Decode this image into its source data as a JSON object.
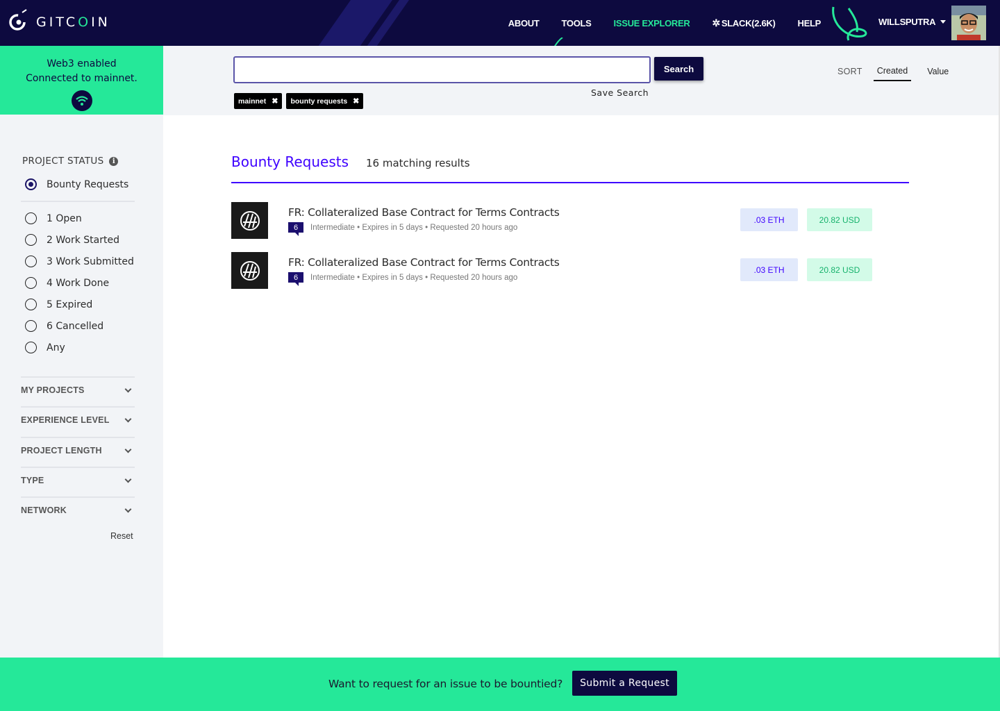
{
  "brand": {
    "logo_text_pre": "GITC",
    "logo_text_o": "O",
    "logo_text_post": "IN",
    "accent": "#25e899",
    "navy": "#0d0a3f",
    "purple": "#3e00ff"
  },
  "nav": {
    "about": "ABOUT",
    "tools": "TOOLS",
    "issue_explorer": "ISSUE EXPLORER",
    "slack": "SLACK(2.6K)",
    "help": "HELP",
    "user": "WILLSPUTRA"
  },
  "web3": {
    "line1": "Web3 enabled",
    "line2": "Connected to mainnet."
  },
  "sidebar": {
    "project_status_label": "PROJECT STATUS",
    "statuses": [
      "Bounty Requests",
      "1 Open",
      "2 Work Started",
      "3 Work Submitted",
      "4 Work Done",
      "5 Expired",
      "6 Cancelled",
      "Any"
    ],
    "selected_status": "Bounty Requests",
    "filters": [
      "MY PROJECTS",
      "EXPERIENCE LEVEL",
      "PROJECT LENGTH",
      "TYPE",
      "NETWORK"
    ],
    "reset": "Reset"
  },
  "search": {
    "value": "",
    "button": "Search",
    "save": "Save Search",
    "chips": [
      "mainnet",
      "bounty requests"
    ]
  },
  "sort": {
    "label": "SORT",
    "options": [
      "Created",
      "Value"
    ],
    "active": "Created"
  },
  "main": {
    "title": "Bounty Requests",
    "count": "16 matching results",
    "bounties": [
      {
        "title": "FR: Collateralized Base Contract for Terms Contracts",
        "comments": "6",
        "meta": "Intermediate • Expires in 5 days • Requested 20 hours ago",
        "eth": ".03 ETH",
        "usd": "20.82 USD"
      },
      {
        "title": "FR: Collateralized Base Contract for Terms Contracts",
        "comments": "6",
        "meta": "Intermediate • Expires in 5 days • Requested 20 hours ago",
        "eth": ".03 ETH",
        "usd": "20.82 USD"
      }
    ]
  },
  "footer": {
    "text": "Want to request for an issue to be bountied?",
    "button": "Submit a Request"
  }
}
